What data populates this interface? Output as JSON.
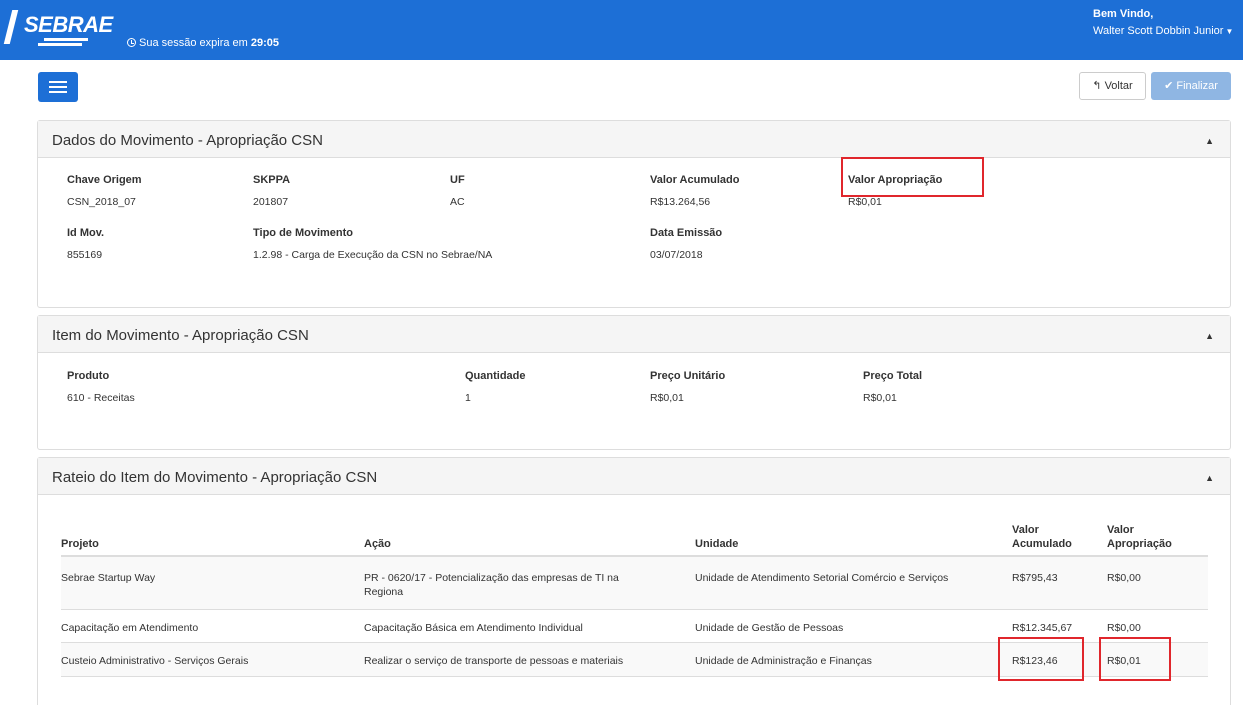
{
  "header": {
    "logo_text": "SEBRAE",
    "session_prefix": "Sua sessão expira em",
    "session_time": "29:05",
    "welcome_line1": "Bem Vindo,",
    "welcome_user": "Walter Scott Dobbin Junior"
  },
  "toolbar": {
    "voltar_label": "Voltar",
    "finalizar_label": "Finalizar"
  },
  "dados": {
    "title": "Dados do Movimento - Apropriação CSN",
    "chave_origem_label": "Chave Origem",
    "chave_origem_value": "CSN_2018_07",
    "skppa_label": "SKPPA",
    "skppa_value": "201807",
    "uf_label": "UF",
    "uf_value": "AC",
    "valor_acumulado_label": "Valor Acumulado",
    "valor_acumulado_value": "R$13.264,56",
    "valor_apropriacao_label": "Valor Apropriação",
    "valor_apropriacao_value": "R$0,01",
    "id_mov_label": "Id Mov.",
    "id_mov_value": "855169",
    "tipo_label": "Tipo de Movimento",
    "tipo_value": "1.2.98 - Carga de Execução da CSN no Sebrae/NA",
    "data_label": "Data Emissão",
    "data_value": "03/07/2018"
  },
  "item": {
    "title": "Item do Movimento - Apropriação CSN",
    "produto_label": "Produto",
    "produto_value": "610 - Receitas",
    "quantidade_label": "Quantidade",
    "quantidade_value": "1",
    "preco_unitario_label": "Preço Unitário",
    "preco_unitario_value": "R$0,01",
    "preco_total_label": "Preço Total",
    "preco_total_value": "R$0,01"
  },
  "rateio": {
    "title": "Rateio do Item do Movimento - Apropriação CSN",
    "headers": {
      "projeto": "Projeto",
      "acao": "Ação",
      "unidade": "Unidade",
      "valor_acumulado_1": "Valor",
      "valor_acumulado_2": "Acumulado",
      "valor_apropriacao_1": "Valor",
      "valor_apropriacao_2": "Apropriação"
    },
    "rows": [
      {
        "projeto": "Sebrae Startup Way",
        "acao_1": "PR - 0620/17 - Potencialização das empresas de TI na",
        "acao_2": "Regiona",
        "unidade": "Unidade de Atendimento Setorial Comércio e Serviços",
        "valor_acumulado": "R$795,43",
        "valor_apropriacao": "R$0,00"
      },
      {
        "projeto": "Capacitação em Atendimento",
        "acao_1": "Capacitação Básica em Atendimento Individual",
        "acao_2": "",
        "unidade": "Unidade de Gestão de Pessoas",
        "valor_acumulado": "R$12.345,67",
        "valor_apropriacao": "R$0,00"
      },
      {
        "projeto": "Custeio Administrativo - Serviços Gerais",
        "acao_1": "Realizar o serviço de transporte de pessoas e materiais",
        "acao_2": "",
        "unidade": "Unidade de Administração e Finanças",
        "valor_acumulado": "R$123,46",
        "valor_apropriacao": "R$0,01"
      }
    ]
  },
  "colors": {
    "brand_blue": "#1d6fd6",
    "highlight_red": "#e0262c",
    "finalizar_disabled": "#8fb6e3"
  }
}
